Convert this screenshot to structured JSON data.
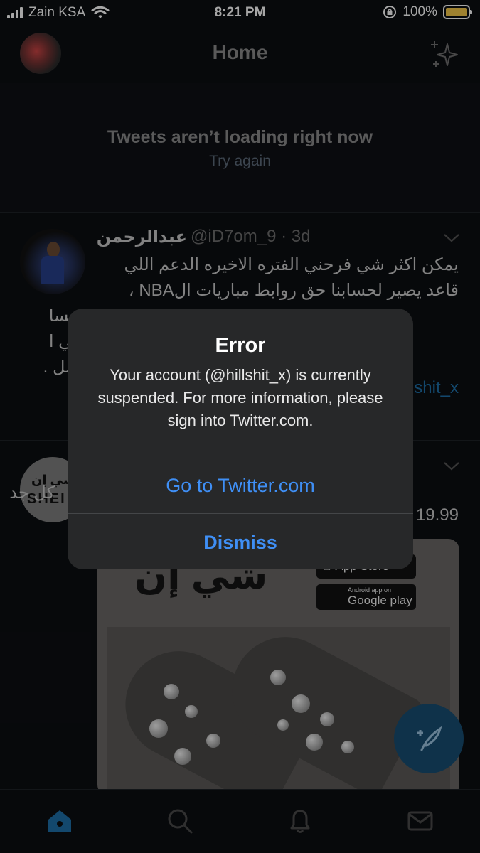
{
  "status_bar": {
    "carrier": "Zain KSA",
    "time": "8:21 PM",
    "battery": "100%"
  },
  "header": {
    "title": "Home"
  },
  "load_error": {
    "message": "Tweets aren’t loading right now",
    "retry": "Try again"
  },
  "tweet1": {
    "name": "عبدالرحمن",
    "handle": "@iD7om_9",
    "age": "· 3d",
    "lines": [
      "يمكن اكثر شي فرحني الفتره الاخيره الدعم اللي",
      "قاعد يصير لحسابنا حق روابط مباريات الNBA ،",
      "الحسا",
      ". في ا",
      "اعمل ."
    ],
    "line1_tail": "الحسا",
    "link_fragment": "shit_x"
  },
  "tweet2": {
    "avatar_ar": "شي إن",
    "avatar_en": "SHEI",
    "line1": "كل جد",
    "line2": "19.99",
    "brand_text": "شي إن",
    "app_store": "App Store",
    "google_play_small": "Android app on",
    "google_play": "Google play"
  },
  "alert": {
    "title": "Error",
    "message": "Your account (@hillshit_x) is currently suspended. For more information, please sign into Twitter.com.",
    "primary_button": "Go to Twitter.com",
    "secondary_button": "Dismiss"
  },
  "colors": {
    "accent": "#3f8ff5",
    "tab_active": "#1e6fa8",
    "battery": "#f5c84a"
  }
}
